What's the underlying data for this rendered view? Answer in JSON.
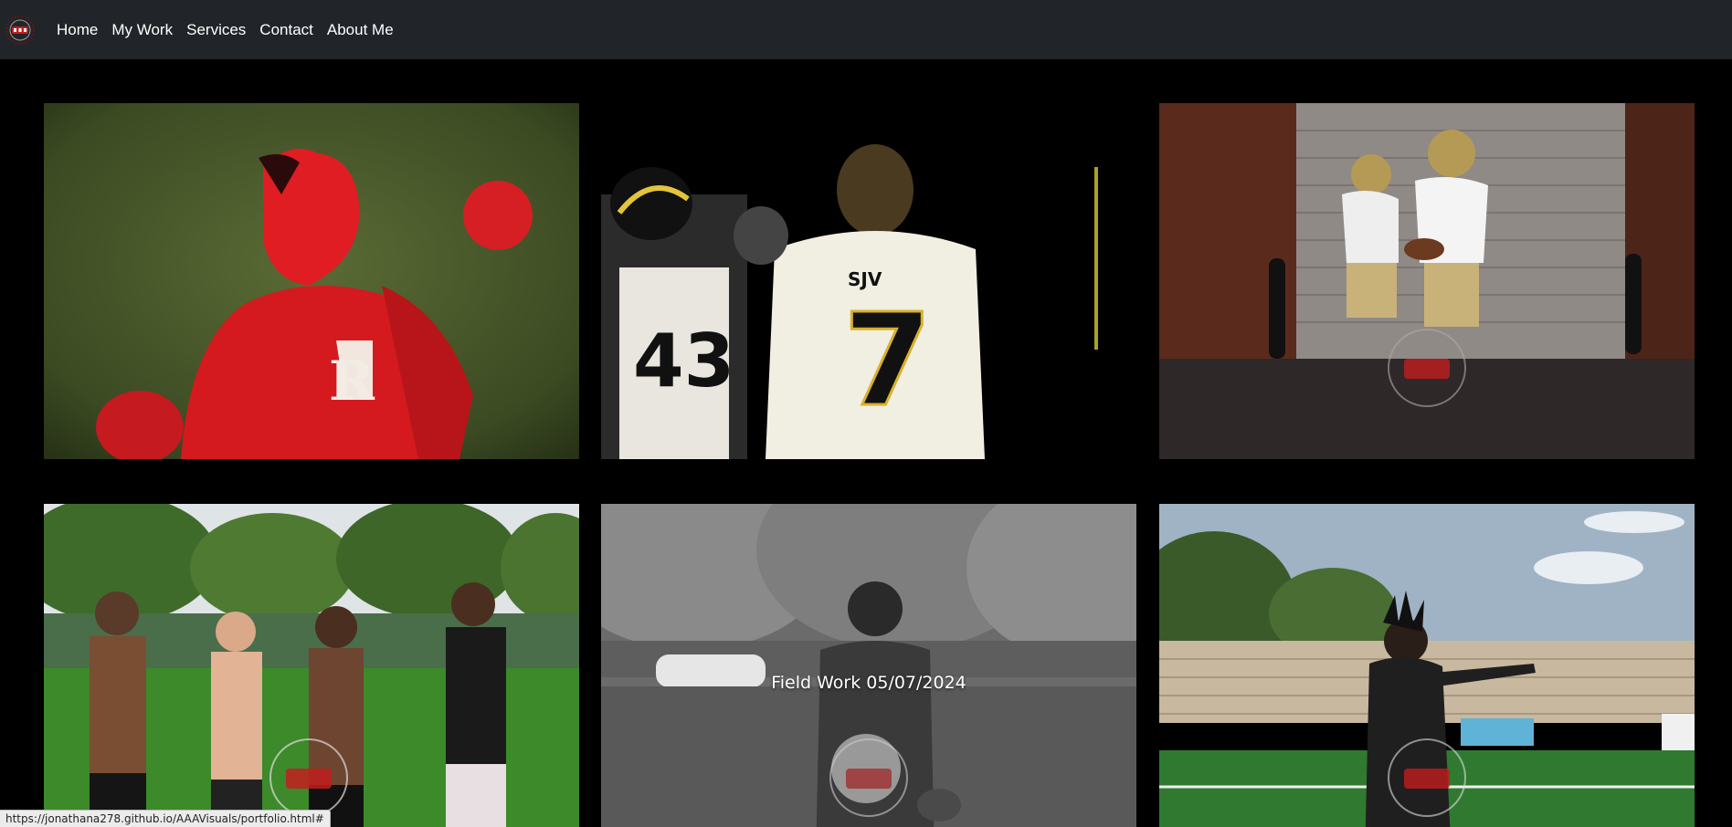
{
  "nav": {
    "logo_icon": "aaa-visuals-logo-icon",
    "items": [
      {
        "label": "Home"
      },
      {
        "label": "My Work"
      },
      {
        "label": "Services"
      },
      {
        "label": "Contact"
      },
      {
        "label": "About Me"
      }
    ]
  },
  "gallery": {
    "tiles": [
      {
        "alt": "Rutgers mascot in red armor on turf"
      },
      {
        "alt": "SJV football players #43 and #7 from behind"
      },
      {
        "alt": "Two players in gold helmets handoff in front of garage door"
      },
      {
        "alt": "Four young athletes posing on a field"
      },
      {
        "alt": "Player holding football in black and white",
        "caption": "Field Work 05/07/2024"
      },
      {
        "alt": "Player pointing on stadium field"
      }
    ]
  },
  "status": {
    "url": "https://jonathana278.github.io/AAAVisuals/portfolio.html#"
  },
  "colors": {
    "navbar_bg": "#212529",
    "page_bg": "#000000",
    "nav_text": "#ffffff"
  }
}
